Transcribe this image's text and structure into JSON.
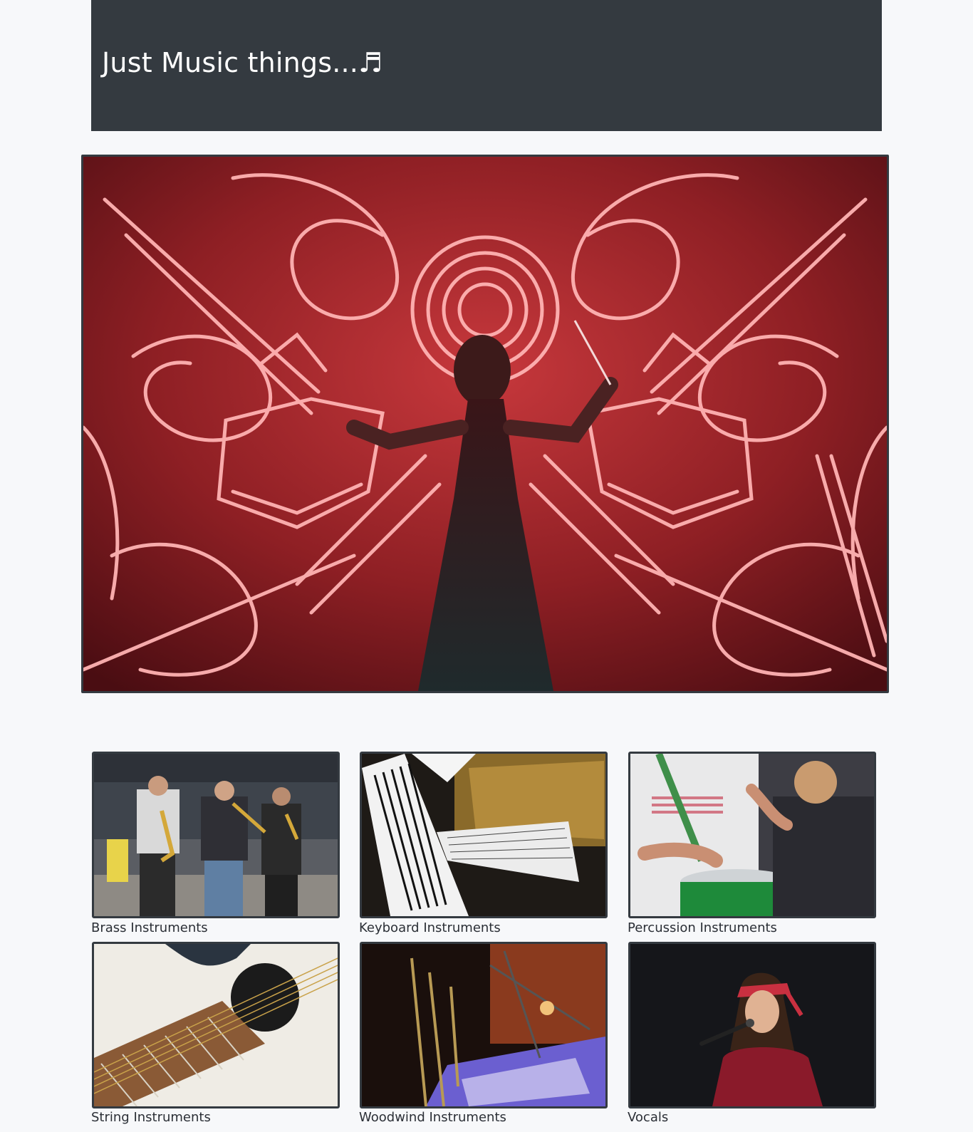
{
  "header": {
    "title": "Just Music things...♬"
  },
  "hero": {
    "image": "neon-orchestra-conductor"
  },
  "categories": [
    {
      "label": "Brass Instruments",
      "image": "brass-street-musicians"
    },
    {
      "label": "Keyboard Instruments",
      "image": "grand-piano-sheet-music"
    },
    {
      "label": "Percussion Instruments",
      "image": "drummers-percussion"
    },
    {
      "label": "String Instruments",
      "image": "acoustic-guitar-closeup"
    },
    {
      "label": "Woodwind Instruments",
      "image": "woodwind-stage"
    },
    {
      "label": "Vocals",
      "image": "singer-microphone"
    }
  ],
  "colors": {
    "page_bg": "#f7f8fa",
    "header_bg": "#343a40",
    "header_text": "#ffffff",
    "frame_border": "#343a40",
    "neon_red": "#ff4a4a"
  }
}
